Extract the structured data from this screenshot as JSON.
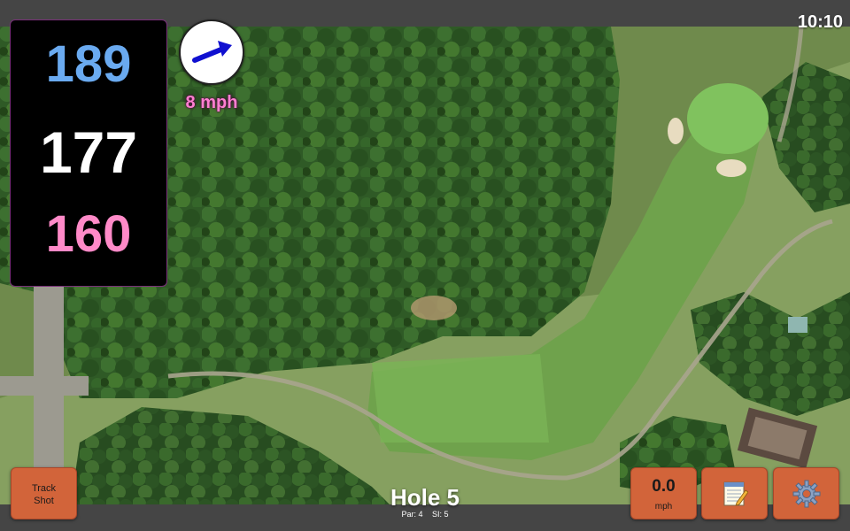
{
  "status": {
    "time": "10:10"
  },
  "yardage": {
    "back": "189",
    "center": "177",
    "front": "160",
    "colors": {
      "back": "#6aaaf0",
      "center": "#ffffff",
      "front": "#ff8ac8"
    }
  },
  "wind": {
    "speed": "8 mph",
    "arrow_icon": "wind-direction-arrow-icon",
    "arrow_color": "#1010d0"
  },
  "hole": {
    "title": "Hole 5",
    "par": "Par: 4",
    "si": "SI: 5"
  },
  "buttons": {
    "track_shot": {
      "line1": "Track",
      "line2": "Shot"
    },
    "speed": {
      "value": "0.0",
      "unit": "mph"
    },
    "notes": {
      "icon": "notepad-icon"
    },
    "settings": {
      "icon": "gear-icon"
    }
  },
  "theme": {
    "button_color": "#d2643a",
    "bar_color": "#454545"
  }
}
